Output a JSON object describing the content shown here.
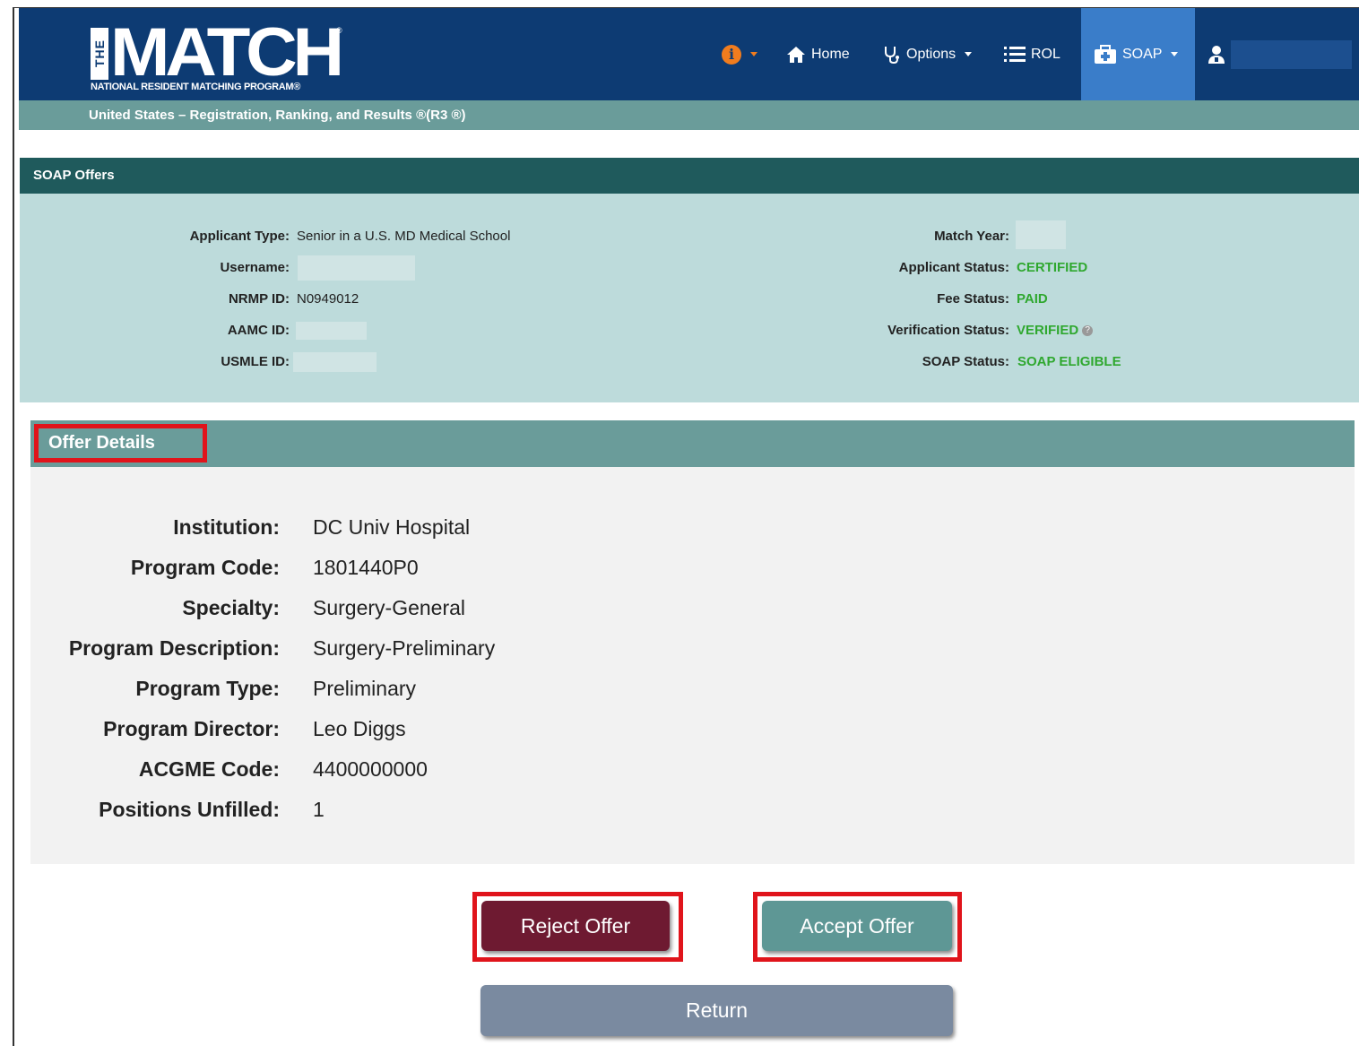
{
  "header": {
    "logo_the": "THE",
    "logo_match": "MATCH",
    "logo_reg": "®",
    "logo_sub": "NATIONAL RESIDENT MATCHING PROGRAM®",
    "nav": {
      "info_icon": "info-circle-icon",
      "home_label": "Home",
      "options_label": "Options",
      "rol_label": "ROL",
      "soap_label": "SOAP"
    },
    "colors": {
      "bar": "#0d3b73",
      "active": "#3a7dc9",
      "info": "#f07c1e"
    }
  },
  "subbar": {
    "text": "United States  –  Registration, Ranking, and Results ®(R3 ®)"
  },
  "soap_offers": {
    "title": "SOAP Offers",
    "left": [
      {
        "label": "Applicant Type:",
        "value": "Senior in a U.S. MD Medical School"
      },
      {
        "label": "Username:",
        "value": ""
      },
      {
        "label": "NRMP ID:",
        "value": "N0949012"
      },
      {
        "label": "AAMC ID:",
        "value": ""
      },
      {
        "label": "USMLE ID:",
        "value": ""
      }
    ],
    "right": [
      {
        "label": "Match Year:",
        "value": ""
      },
      {
        "label": "Applicant Status:",
        "value": "CERTIFIED"
      },
      {
        "label": "Fee Status:",
        "value": "PAID"
      },
      {
        "label": "Verification Status:",
        "value": "VERIFIED"
      },
      {
        "label": "SOAP Status:",
        "value": "SOAP ELIGIBLE"
      }
    ]
  },
  "offer_details": {
    "title": "Offer Details",
    "rows": [
      {
        "label": "Institution:",
        "value": "DC Univ Hospital"
      },
      {
        "label": "Program Code:",
        "value": "1801440P0"
      },
      {
        "label": "Specialty:",
        "value": "Surgery-General"
      },
      {
        "label": "Program Description:",
        "value": "Surgery-Preliminary"
      },
      {
        "label": "Program Type:",
        "value": "Preliminary"
      },
      {
        "label": "Program Director:",
        "value": "Leo Diggs"
      },
      {
        "label": "ACGME Code:",
        "value": "4400000000"
      },
      {
        "label": "Positions Unfilled:",
        "value": "1"
      }
    ]
  },
  "actions": {
    "reject_label": "Reject Offer",
    "accept_label": "Accept Offer",
    "return_label": "Return"
  }
}
